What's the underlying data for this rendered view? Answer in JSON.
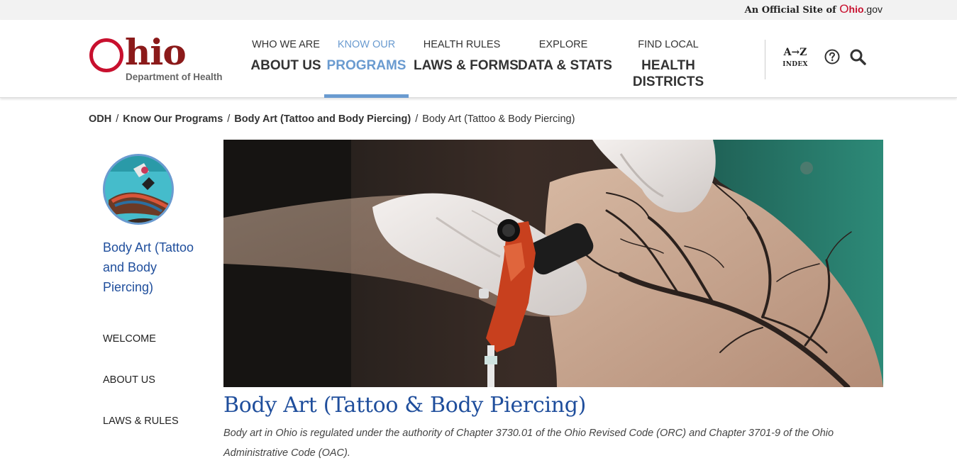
{
  "topbar": {
    "official_prefix": "An Official Site of",
    "gov_o": "O",
    "gov_hio": "hio",
    "gov_suffix": ".gov"
  },
  "logo": {
    "wordmark": "hio",
    "department": "Department of Health"
  },
  "nav": {
    "items": [
      {
        "small": "WHO WE ARE",
        "big": "ABOUT US",
        "active": false
      },
      {
        "small": "KNOW OUR",
        "big": "PROGRAMS",
        "active": true
      },
      {
        "small": "HEALTH RULES",
        "big": "LAWS & FORMS",
        "active": false
      },
      {
        "small": "EXPLORE",
        "big": "DATA & STATS",
        "active": false
      },
      {
        "small": "FIND LOCAL",
        "big": "HEALTH DISTRICTS",
        "big_line1": "HEALTH",
        "big_line2": "DISTRICTS",
        "active": false
      }
    ],
    "az_label": "A→Z",
    "az_sub": "INDEX",
    "help_icon": "question-circle-icon",
    "search_icon": "search-icon"
  },
  "breadcrumb": {
    "items": [
      "ODH",
      "Know Our Programs",
      "Body Art (Tattoo and Body Piercing)"
    ],
    "current": "Body Art (Tattoo & Body Piercing)"
  },
  "sidebar": {
    "title": "Body Art (Tattoo and Body Piercing)",
    "links": [
      "WELCOME",
      "ABOUT US",
      "LAWS & RULES"
    ]
  },
  "main": {
    "title": "Body Art (Tattoo & Body Piercing)",
    "intro": "Body art in Ohio is regulated under the authority of Chapter 3730.01 of the Ohio Revised Code (ORC) and Chapter 3701-9 of the Ohio Administrative Code (OAC)."
  },
  "colors": {
    "brand_red": "#c8102e",
    "link_blue": "#1f4e9c",
    "active_nav": "#6a9bd0"
  }
}
